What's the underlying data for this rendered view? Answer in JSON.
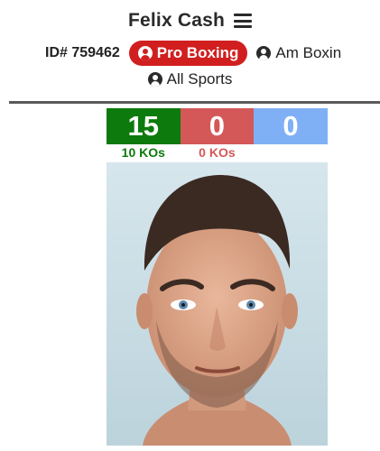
{
  "header": {
    "boxer_name": "Felix Cash"
  },
  "nav": {
    "id_label": "ID# 759462",
    "tabs": [
      {
        "label": "Pro Boxing",
        "active": true
      },
      {
        "label": "Am Boxin",
        "active": false
      },
      {
        "label": "All Sports",
        "active": false
      }
    ]
  },
  "record": {
    "wins": "15",
    "losses": "0",
    "draws": "0",
    "win_kos": "10 KOs",
    "loss_kos": "0 KOs"
  },
  "colors": {
    "pro_pill": "#d11f1f",
    "win": "#0d7a0d",
    "loss": "#d45858",
    "draw": "#7fb0f5"
  },
  "icons": [
    "menu-icon",
    "user-circle-icon"
  ],
  "photo": {
    "subject": "boxer-headshot"
  }
}
